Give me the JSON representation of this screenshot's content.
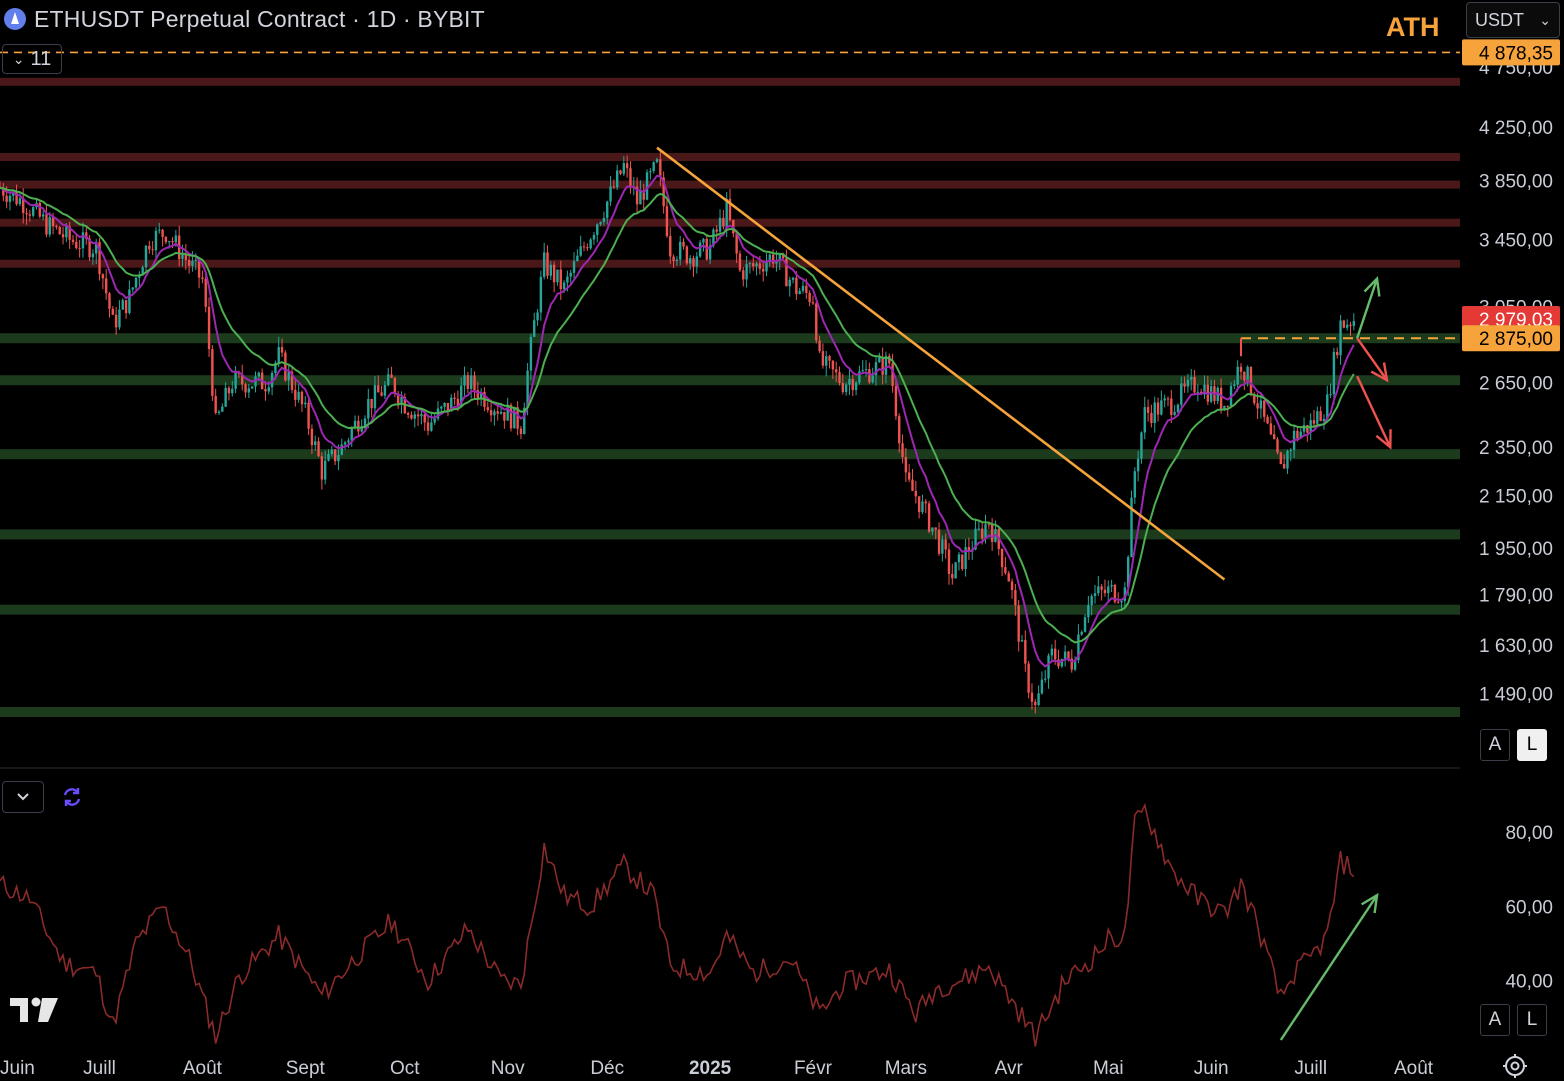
{
  "header": {
    "title": "ETHUSDT Perpetual Contract · 1D · BYBIT",
    "interval_label": "11",
    "currency": "USDT",
    "ath_label": "ATH"
  },
  "icons": {
    "symbol": "ethereum-icon",
    "interval_toggle": "chevron-down-icon",
    "currency_toggle": "chevron-down-icon",
    "indicator_toggle": "chevron-down-icon",
    "indicator_refresh": "refresh-icon",
    "logo": "tradingview-logo",
    "settings": "gear-icon"
  },
  "scale_buttons": {
    "auto": "A",
    "log": "L"
  },
  "colors": {
    "up_candle": "#26a69a",
    "down_candle": "#ef5350",
    "ema_fast": "#9c27b0",
    "ema_slow": "#4caf50",
    "trendline": "#f5a33a",
    "resistance_zone": "#4a1818",
    "support_zone": "#1c3a1c",
    "rsi_line": "#8b2a2a",
    "current_price_badge": "#e53935",
    "level_badge": "#f5a33a"
  },
  "chart_data": [
    {
      "type": "candlestick",
      "title": "ETHUSDT Perpetual Contract · 1D · BYBIT",
      "log_scale": true,
      "y_tick_labels": [
        "4 750,00",
        "4 250,00",
        "3 850,00",
        "3 450,00",
        "3 050,00",
        "2 650,00",
        "2 350,00",
        "2 150,00",
        "1 950,00",
        "1 790,00",
        "1 630,00",
        "1 490,00"
      ],
      "y_ticks": [
        4750,
        4250,
        3850,
        3450,
        3050,
        2650,
        2350,
        2150,
        1950,
        1790,
        1630,
        1490
      ],
      "ylim": [
        1380,
        4900
      ],
      "x_tick_labels": [
        "Juin",
        "Juill",
        "Août",
        "Sept",
        "Oct",
        "Nov",
        "Déc",
        "2025",
        "Févr",
        "Mars",
        "Avr",
        "Mai",
        "Juin",
        "Juill",
        "Août"
      ],
      "x_ticks": [
        "2024-06-01",
        "2024-07-01",
        "2024-08-01",
        "2024-09-01",
        "2024-10-01",
        "2024-11-01",
        "2024-12-01",
        "2025-01-01",
        "2025-02-01",
        "2025-03-01",
        "2025-04-01",
        "2025-05-01",
        "2025-06-01",
        "2025-07-01",
        "2025-08-01"
      ],
      "xlim": [
        "2024-06-01",
        "2025-08-15"
      ],
      "price_path": [
        [
          "2024-06-01",
          3800
        ],
        [
          "2024-06-08",
          3700
        ],
        [
          "2024-06-15",
          3550
        ],
        [
          "2024-06-22",
          3450
        ],
        [
          "2024-06-30",
          3400
        ],
        [
          "2024-07-05",
          2950
        ],
        [
          "2024-07-10",
          3100
        ],
        [
          "2024-07-16",
          3450
        ],
        [
          "2024-07-21",
          3500
        ],
        [
          "2024-07-28",
          3300
        ],
        [
          "2024-08-01",
          3200
        ],
        [
          "2024-08-05",
          2450
        ],
        [
          "2024-08-10",
          2650
        ],
        [
          "2024-08-20",
          2650
        ],
        [
          "2024-08-24",
          2780
        ],
        [
          "2024-09-01",
          2500
        ],
        [
          "2024-09-06",
          2250
        ],
        [
          "2024-09-12",
          2350
        ],
        [
          "2024-09-20",
          2550
        ],
        [
          "2024-09-27",
          2650
        ],
        [
          "2024-10-01",
          2550
        ],
        [
          "2024-10-08",
          2450
        ],
        [
          "2024-10-15",
          2550
        ],
        [
          "2024-10-20",
          2650
        ],
        [
          "2024-10-27",
          2550
        ],
        [
          "2024-11-01",
          2500
        ],
        [
          "2024-11-05",
          2450
        ],
        [
          "2024-11-09",
          2950
        ],
        [
          "2024-11-12",
          3300
        ],
        [
          "2024-11-18",
          3150
        ],
        [
          "2024-11-25",
          3450
        ],
        [
          "2024-12-01",
          3700
        ],
        [
          "2024-12-06",
          3950
        ],
        [
          "2024-12-10",
          3700
        ],
        [
          "2024-12-16",
          3950
        ],
        [
          "2024-12-20",
          3400
        ],
        [
          "2024-12-26",
          3350
        ],
        [
          "2025-01-01",
          3400
        ],
        [
          "2025-01-06",
          3650
        ],
        [
          "2025-01-10",
          3250
        ],
        [
          "2025-01-16",
          3300
        ],
        [
          "2025-01-20",
          3350
        ],
        [
          "2025-01-27",
          3150
        ],
        [
          "2025-02-01",
          3100
        ],
        [
          "2025-02-03",
          2750
        ],
        [
          "2025-02-10",
          2650
        ],
        [
          "2025-02-17",
          2700
        ],
        [
          "2025-02-24",
          2750
        ],
        [
          "2025-03-01",
          2200
        ],
        [
          "2025-03-04",
          2150
        ],
        [
          "2025-03-10",
          2000
        ],
        [
          "2025-03-15",
          1850
        ],
        [
          "2025-03-20",
          1950
        ],
        [
          "2025-03-26",
          2050
        ],
        [
          "2025-04-01",
          1850
        ],
        [
          "2025-04-06",
          1550
        ],
        [
          "2025-04-09",
          1450
        ],
        [
          "2025-04-14",
          1600
        ],
        [
          "2025-04-20",
          1580
        ],
        [
          "2025-04-25",
          1780
        ],
        [
          "2025-05-01",
          1800
        ],
        [
          "2025-05-06",
          1800
        ],
        [
          "2025-05-09",
          2250
        ],
        [
          "2025-05-12",
          2500
        ],
        [
          "2025-05-20",
          2550
        ],
        [
          "2025-05-28",
          2650
        ],
        [
          "2025-06-05",
          2550
        ],
        [
          "2025-06-10",
          2750
        ],
        [
          "2025-06-15",
          2550
        ],
        [
          "2025-06-22",
          2250
        ],
        [
          "2025-06-26",
          2400
        ],
        [
          "2025-07-01",
          2450
        ],
        [
          "2025-07-06",
          2550
        ],
        [
          "2025-07-10",
          2950
        ],
        [
          "2025-07-14",
          2979.03
        ]
      ],
      "horizontal_zones": {
        "resistance": [
          4620,
          4020,
          3820,
          3560,
          3300
        ],
        "support": [
          2875,
          2660,
          2320,
          2000,
          1740,
          1440
        ]
      },
      "trendline": {
        "from": [
          "2024-12-16",
          4090
        ],
        "to": [
          "2025-06-05",
          1840
        ]
      },
      "ath_level": 4878.35,
      "ath_badge": "4 878,35",
      "breakout_level": 2875,
      "breakout_badge": "2 875,00",
      "breakout_line_start": "2025-06-10",
      "current_price": 2979.03,
      "current_price_badge": "2 979,03",
      "annotations": [
        {
          "kind": "arrow",
          "color": "green",
          "from": [
            "2025-07-15",
            2875
          ],
          "to": [
            "2025-07-21",
            3210
          ]
        },
        {
          "kind": "arrow",
          "color": "red",
          "from": [
            "2025-07-15",
            2875
          ],
          "to": [
            "2025-07-24",
            2660
          ]
        },
        {
          "kind": "arrow",
          "color": "red",
          "from": [
            "2025-07-15",
            2680
          ],
          "to": [
            "2025-07-25",
            2350
          ]
        }
      ]
    },
    {
      "type": "line",
      "y_tick_labels": [
        "80,00",
        "60,00",
        "40,00"
      ],
      "y_ticks": [
        80,
        60,
        40
      ],
      "ylim": [
        24,
        90
      ],
      "path": [
        [
          "2024-06-01",
          66
        ],
        [
          "2024-06-10",
          62
        ],
        [
          "2024-06-20",
          45
        ],
        [
          "2024-06-30",
          42
        ],
        [
          "2024-07-05",
          28
        ],
        [
          "2024-07-12",
          50
        ],
        [
          "2024-07-20",
          60
        ],
        [
          "2024-07-28",
          46
        ],
        [
          "2024-08-05",
          25
        ],
        [
          "2024-08-12",
          41
        ],
        [
          "2024-08-24",
          52
        ],
        [
          "2024-09-06",
          36
        ],
        [
          "2024-09-15",
          45
        ],
        [
          "2024-09-27",
          56
        ],
        [
          "2024-10-08",
          40
        ],
        [
          "2024-10-20",
          54
        ],
        [
          "2024-10-30",
          40
        ],
        [
          "2024-11-05",
          39
        ],
        [
          "2024-11-12",
          76
        ],
        [
          "2024-11-18",
          63
        ],
        [
          "2024-11-26",
          60
        ],
        [
          "2024-12-06",
          71
        ],
        [
          "2024-12-15",
          63
        ],
        [
          "2024-12-20",
          44
        ],
        [
          "2025-01-01",
          42
        ],
        [
          "2025-01-06",
          52
        ],
        [
          "2025-01-14",
          42
        ],
        [
          "2025-01-25",
          46
        ],
        [
          "2025-02-03",
          31
        ],
        [
          "2025-02-10",
          39
        ],
        [
          "2025-02-24",
          43
        ],
        [
          "2025-03-04",
          31
        ],
        [
          "2025-03-10",
          38
        ],
        [
          "2025-03-20",
          41
        ],
        [
          "2025-03-26",
          44
        ],
        [
          "2025-04-06",
          29
        ],
        [
          "2025-04-09",
          25
        ],
        [
          "2025-04-18",
          40
        ],
        [
          "2025-04-25",
          45
        ],
        [
          "2025-05-01",
          51
        ],
        [
          "2025-05-06",
          52
        ],
        [
          "2025-05-09",
          82
        ],
        [
          "2025-05-12",
          86
        ],
        [
          "2025-05-20",
          70
        ],
        [
          "2025-05-28",
          62
        ],
        [
          "2025-06-05",
          58
        ],
        [
          "2025-06-10",
          66
        ],
        [
          "2025-06-15",
          55
        ],
        [
          "2025-06-22",
          35
        ],
        [
          "2025-06-26",
          42
        ],
        [
          "2025-07-01",
          46
        ],
        [
          "2025-07-06",
          52
        ],
        [
          "2025-07-10",
          72
        ],
        [
          "2025-07-14",
          70
        ]
      ],
      "annotations": [
        {
          "kind": "arrow",
          "color": "green",
          "from": [
            "2025-06-22",
            24
          ],
          "to": [
            "2025-07-21",
            63
          ]
        }
      ]
    }
  ]
}
